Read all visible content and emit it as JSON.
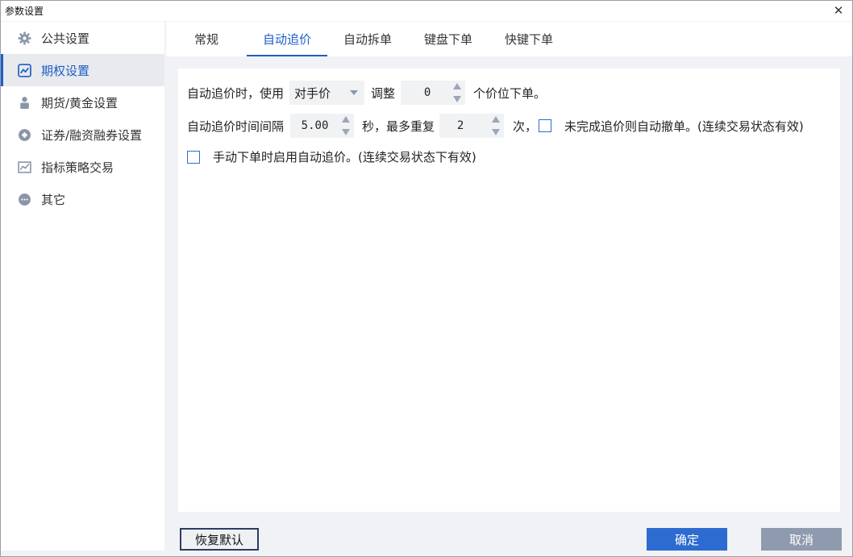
{
  "window": {
    "title": "参数设置"
  },
  "sidebar": {
    "items": [
      {
        "label": "公共设置",
        "icon": "gear-icon"
      },
      {
        "label": "期权设置",
        "icon": "chart-icon",
        "active": true
      },
      {
        "label": "期货/黄金设置",
        "icon": "person-icon"
      },
      {
        "label": "证券/融资融券设置",
        "icon": "diamond-icon"
      },
      {
        "label": "指标策略交易",
        "icon": "trend-icon"
      },
      {
        "label": "其它",
        "icon": "more-icon"
      }
    ]
  },
  "tabs": [
    {
      "label": "常规"
    },
    {
      "label": "自动追价",
      "active": true
    },
    {
      "label": "自动拆单"
    },
    {
      "label": "键盘下单"
    },
    {
      "label": "快键下单"
    }
  ],
  "form": {
    "row1": {
      "prefix": "自动追价时，使用",
      "price_select_value": "对手价",
      "adjust_label": "调整",
      "adjust_value": "0",
      "suffix": "个价位下单。"
    },
    "row2": {
      "prefix": "自动追价时间间隔",
      "interval_value": "5.00",
      "mid": "秒，最多重复",
      "repeat_value": "2",
      "times": "次，",
      "checkbox_label": "未完成追价则自动撤单。(连续交易状态有效)"
    },
    "row3": {
      "checkbox_label": "手动下单时启用自动追价。(连续交易状态下有效)"
    }
  },
  "buttons": {
    "reset": "恢复默认",
    "ok": "确定",
    "cancel": "取消"
  },
  "colors": {
    "accent": "#1f5ec7",
    "ok_button": "#2d6bd1",
    "cancel_button": "#8f9aae"
  }
}
